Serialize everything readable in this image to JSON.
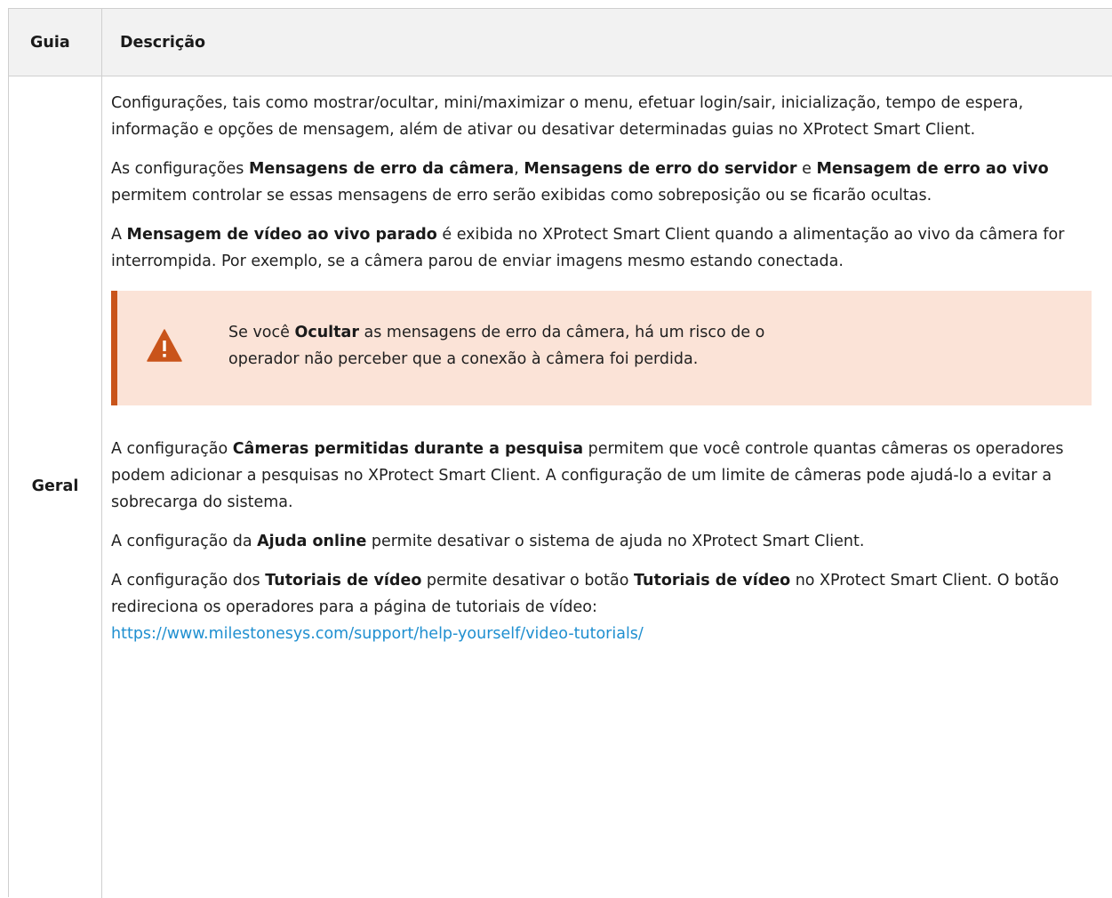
{
  "table": {
    "header": {
      "col1": "Guia",
      "col2": "Descrição"
    },
    "row": {
      "tab_name": "Geral",
      "p1": "Configurações, tais como mostrar/ocultar, mini/maximizar o menu, efetuar login/sair, inicialização, tempo de espera, informação e opções de mensagem, além de ativar ou desativar determinadas guias no XProtect Smart Client.",
      "p2": {
        "t1": "As configurações ",
        "b1": "Mensagens de erro da câmera",
        "t2": ", ",
        "b2": "Mensagens de erro do servidor",
        "t3": " e ",
        "b3": "Mensagem de erro ao vivo",
        "t4": " permitem controlar se essas mensagens de erro serão exibidas como sobreposição ou se ficarão ocultas."
      },
      "p3": {
        "t1": "A ",
        "b1": "Mensagem de vídeo ao vivo parado",
        "t2": " é exibida no XProtect Smart Client quando a alimentação ao vivo da câmera for interrompida. Por exemplo, se a câmera parou de enviar imagens mesmo estando conectada."
      },
      "warning": {
        "icon": "warning-triangle-icon",
        "t1": "Se você ",
        "b1": "Ocultar",
        "t2": " as mensagens de erro da câmera, há um risco de o",
        "t3": "operador não perceber que a conexão à câmera foi perdida."
      },
      "p4": {
        "t1": "A configuração ",
        "b1": "Câmeras permitidas durante a pesquisa",
        "t2": " permitem que você controle quantas câmeras os operadores podem adicionar a pesquisas no XProtect Smart Client. A configuração de um limite de câmeras pode ajudá-lo a evitar a sobrecarga do sistema."
      },
      "p5": {
        "t1": "A configuração da ",
        "b1": "Ajuda online",
        "t2": " permite desativar o sistema de ajuda no XProtect Smart Client."
      },
      "p6": {
        "t1": "A configuração dos ",
        "b1": "Tutoriais de vídeo",
        "t2": " permite desativar o botão ",
        "b2": "Tutoriais de vídeo",
        "t3": " no XProtect Smart Client. O botão redireciona os operadores para a página de tutoriais de vídeo:",
        "link": "https://www.milestonesys.com/support/help-yourself/video-tutorials/"
      }
    }
  },
  "colors": {
    "header_bg": "#f2f2f2",
    "border": "#cfcfcf",
    "warning_bg": "#fbe3d7",
    "warning_accent": "#c9541a",
    "link": "#1f8fd0"
  }
}
